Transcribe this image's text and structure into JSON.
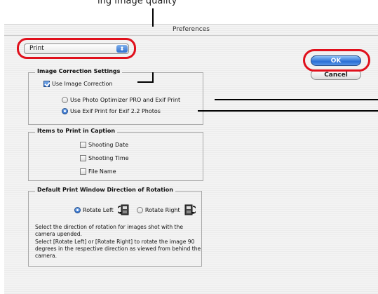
{
  "top_caption": "ing image quality",
  "dialog": {
    "title": "Preferences",
    "popup_value": "Print",
    "popup_arrows": "⬍",
    "ok_label": "OK",
    "cancel_label": "Cancel"
  },
  "image_correction": {
    "title": "Image Correction Settings",
    "use_image_correction": {
      "label": "Use Image Correction",
      "checked": true
    },
    "radio_photo_optimizer": {
      "label": "Use Photo Optimizer PRO and Exif Print",
      "selected": false
    },
    "radio_exif_print": {
      "label": "Use Exif Print for Exif 2.2 Photos",
      "selected": true
    }
  },
  "caption": {
    "title": "Items to Print in Caption",
    "items": [
      {
        "label": "Shooting Date",
        "checked": false
      },
      {
        "label": "Shooting Time",
        "checked": false
      },
      {
        "label": "File Name",
        "checked": false
      }
    ]
  },
  "rotation": {
    "title": "Default Print Window Direction of Rotation",
    "rotate_left": {
      "label": "Rotate Left",
      "selected": true,
      "icon": "rotate-left-icon"
    },
    "rotate_right": {
      "label": "Rotate Right",
      "selected": false,
      "icon": "rotate-right-icon"
    },
    "description_1": "Select the direction of rotation for images shot with the camera upended.",
    "description_2": "Select [Rotate Left] or [Rotate Right] to rotate the image 90 degrees in the respective direction as viewed from behind the camera."
  },
  "colors": {
    "callout_red": "#e0101c",
    "selected_blue": "#2f6fd0"
  }
}
